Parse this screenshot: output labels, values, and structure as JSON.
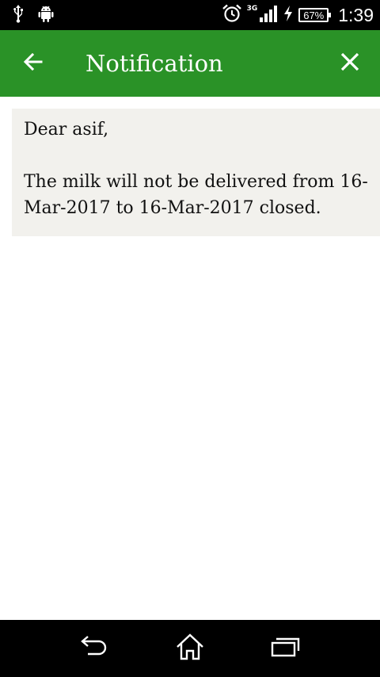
{
  "status_bar": {
    "network_type": "3G",
    "battery_percent": "67%",
    "time": "1:39",
    "icons": [
      "usb-icon",
      "android-icon",
      "alarm-icon",
      "signal-icon",
      "charging-icon",
      "battery-icon"
    ]
  },
  "app_bar": {
    "title": "Notification",
    "background_color": "#2a9227",
    "back_icon": "back-arrow-icon",
    "close_icon": "close-icon"
  },
  "notification": {
    "greeting": "Dear asif,",
    "message": "The milk will not be delivered from 16-Mar-2017 to 16-Mar-2017 closed."
  },
  "nav_bar": {
    "icons": [
      "back-nav-icon",
      "home-icon",
      "recent-apps-icon"
    ]
  }
}
